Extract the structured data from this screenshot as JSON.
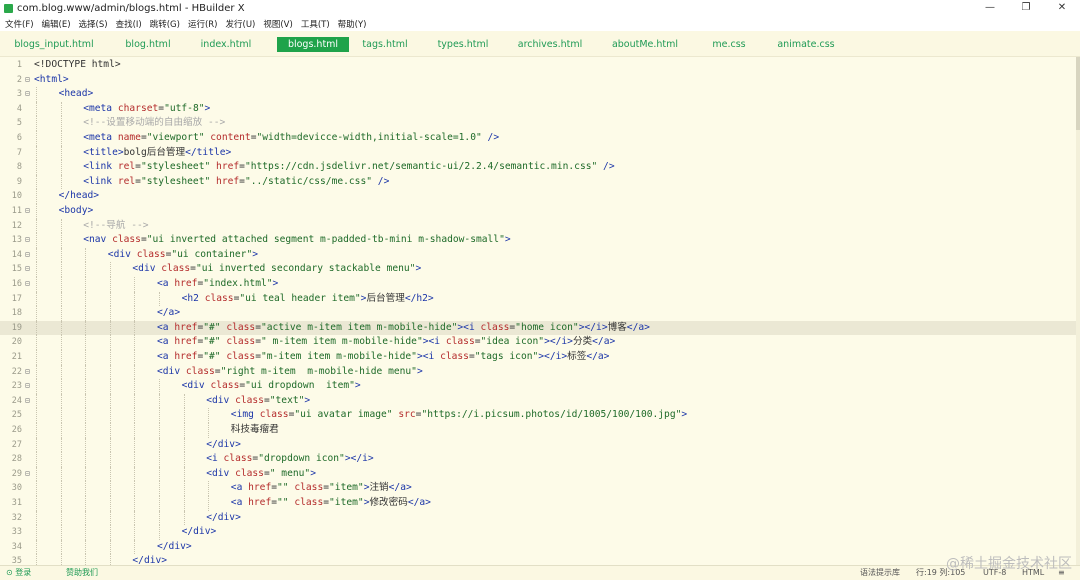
{
  "window": {
    "title": "com.blog.www/admin/blogs.html - HBuilder X",
    "minimize": "—",
    "maximize": "❐",
    "close": "✕"
  },
  "menu": [
    "文件(F)",
    "编辑(E)",
    "选择(S)",
    "查找(I)",
    "跳转(G)",
    "运行(R)",
    "发行(U)",
    "视图(V)",
    "工具(T)",
    "帮助(Y)"
  ],
  "tabs": [
    {
      "label": "blogs_input.html",
      "active": false
    },
    {
      "label": "blog.html",
      "active": false
    },
    {
      "label": "index.html",
      "active": false
    },
    {
      "label": "blogs.html",
      "active": true
    },
    {
      "label": "tags.html",
      "active": false
    },
    {
      "label": "types.html",
      "active": false
    },
    {
      "label": "archives.html",
      "active": false
    },
    {
      "label": "aboutMe.html",
      "active": false
    },
    {
      "label": "me.css",
      "active": false
    },
    {
      "label": "animate.css",
      "active": false
    }
  ],
  "editor": {
    "highlighted_line": 19,
    "lines": [
      {
        "n": "1",
        "fold": "",
        "indent": 0,
        "tokens": [
          [
            "txt",
            "<!DOCTYPE html>"
          ]
        ]
      },
      {
        "n": "2",
        "fold": "⊟",
        "indent": 0,
        "tokens": [
          [
            "tag",
            "<html>"
          ]
        ]
      },
      {
        "n": "3",
        "fold": "⊟",
        "indent": 1,
        "tokens": [
          [
            "tag",
            "<head>"
          ]
        ]
      },
      {
        "n": "4",
        "fold": "",
        "indent": 2,
        "tokens": [
          [
            "tag",
            "<meta "
          ],
          [
            "attr",
            "charset"
          ],
          [
            "txt",
            "="
          ],
          [
            "val",
            "\"utf-8\""
          ],
          [
            "tag",
            ">"
          ]
        ]
      },
      {
        "n": "5",
        "fold": "",
        "indent": 2,
        "tokens": [
          [
            "com",
            "<!--设置移动端的自由缩放 -->"
          ]
        ]
      },
      {
        "n": "6",
        "fold": "",
        "indent": 2,
        "tokens": [
          [
            "tag",
            "<meta "
          ],
          [
            "attr",
            "name"
          ],
          [
            "txt",
            "="
          ],
          [
            "val",
            "\"viewport\""
          ],
          [
            "txt",
            " "
          ],
          [
            "attr",
            "content"
          ],
          [
            "txt",
            "="
          ],
          [
            "val",
            "\"width=devicce-width,initial-scale=1.0\""
          ],
          [
            "tag",
            " />"
          ]
        ]
      },
      {
        "n": "7",
        "fold": "",
        "indent": 2,
        "tokens": [
          [
            "tag",
            "<title>"
          ],
          [
            "txt",
            "bolg后台管理"
          ],
          [
            "tag",
            "</title>"
          ]
        ]
      },
      {
        "n": "8",
        "fold": "",
        "indent": 2,
        "tokens": [
          [
            "tag",
            "<link "
          ],
          [
            "attr",
            "rel"
          ],
          [
            "txt",
            "="
          ],
          [
            "val",
            "\"stylesheet\""
          ],
          [
            "txt",
            " "
          ],
          [
            "attr",
            "href"
          ],
          [
            "txt",
            "="
          ],
          [
            "val",
            "\"https://cdn.jsdelivr.net/semantic-ui/2.2.4/semantic.min.css\""
          ],
          [
            "tag",
            " />"
          ]
        ]
      },
      {
        "n": "9",
        "fold": "",
        "indent": 2,
        "tokens": [
          [
            "tag",
            "<link "
          ],
          [
            "attr",
            "rel"
          ],
          [
            "txt",
            "="
          ],
          [
            "val",
            "\"stylesheet\""
          ],
          [
            "txt",
            " "
          ],
          [
            "attr",
            "href"
          ],
          [
            "txt",
            "="
          ],
          [
            "val",
            "\"../static/css/me.css\""
          ],
          [
            "tag",
            " />"
          ]
        ]
      },
      {
        "n": "10",
        "fold": "",
        "indent": 1,
        "tokens": [
          [
            "tag",
            "</head>"
          ]
        ]
      },
      {
        "n": "11",
        "fold": "⊟",
        "indent": 1,
        "tokens": [
          [
            "tag",
            "<body>"
          ]
        ]
      },
      {
        "n": "12",
        "fold": "",
        "indent": 2,
        "tokens": [
          [
            "com",
            "<!--导航 -->"
          ]
        ]
      },
      {
        "n": "13",
        "fold": "⊟",
        "indent": 2,
        "tokens": [
          [
            "tag",
            "<nav "
          ],
          [
            "attr",
            "class"
          ],
          [
            "txt",
            "="
          ],
          [
            "val",
            "\"ui inverted attached segment m-padded-tb-mini m-shadow-small\""
          ],
          [
            "tag",
            ">"
          ]
        ]
      },
      {
        "n": "14",
        "fold": "⊟",
        "indent": 3,
        "tokens": [
          [
            "tag",
            "<div "
          ],
          [
            "attr",
            "class"
          ],
          [
            "txt",
            "="
          ],
          [
            "val",
            "\"ui container\""
          ],
          [
            "tag",
            ">"
          ]
        ]
      },
      {
        "n": "15",
        "fold": "⊟",
        "indent": 4,
        "tokens": [
          [
            "tag",
            "<div "
          ],
          [
            "attr",
            "class"
          ],
          [
            "txt",
            "="
          ],
          [
            "val",
            "\"ui inverted secondary stackable menu\""
          ],
          [
            "tag",
            ">"
          ]
        ]
      },
      {
        "n": "16",
        "fold": "⊟",
        "indent": 5,
        "tokens": [
          [
            "tag",
            "<a "
          ],
          [
            "attr",
            "href"
          ],
          [
            "txt",
            "="
          ],
          [
            "val",
            "\"index.html\""
          ],
          [
            "tag",
            ">"
          ]
        ]
      },
      {
        "n": "17",
        "fold": "",
        "indent": 6,
        "tokens": [
          [
            "tag",
            "<h2 "
          ],
          [
            "attr",
            "class"
          ],
          [
            "txt",
            "="
          ],
          [
            "val",
            "\"ui teal header item\""
          ],
          [
            "tag",
            ">"
          ],
          [
            "txt",
            "后台管理"
          ],
          [
            "tag",
            "</h2>"
          ]
        ]
      },
      {
        "n": "18",
        "fold": "",
        "indent": 5,
        "tokens": [
          [
            "tag",
            "</a>"
          ]
        ]
      },
      {
        "n": "19",
        "fold": "",
        "indent": 5,
        "tokens": [
          [
            "tag",
            "<a "
          ],
          [
            "attr",
            "href"
          ],
          [
            "txt",
            "="
          ],
          [
            "val",
            "\"#\""
          ],
          [
            "txt",
            " "
          ],
          [
            "attr",
            "class"
          ],
          [
            "txt",
            "="
          ],
          [
            "val",
            "\"active m-item item m-mobile-hide\""
          ],
          [
            "tag",
            ">"
          ],
          [
            "tag",
            "<i "
          ],
          [
            "attr",
            "class"
          ],
          [
            "txt",
            "="
          ],
          [
            "val",
            "\"home icon\""
          ],
          [
            "tag",
            "></i>"
          ],
          [
            "txt",
            "博客"
          ],
          [
            "tag",
            "</a>"
          ]
        ]
      },
      {
        "n": "20",
        "fold": "",
        "indent": 5,
        "tokens": [
          [
            "tag",
            "<a "
          ],
          [
            "attr",
            "href"
          ],
          [
            "txt",
            "="
          ],
          [
            "val",
            "\"#\""
          ],
          [
            "txt",
            " "
          ],
          [
            "attr",
            "class"
          ],
          [
            "txt",
            "="
          ],
          [
            "val",
            "\" m-item item m-mobile-hide\""
          ],
          [
            "tag",
            ">"
          ],
          [
            "tag",
            "<i "
          ],
          [
            "attr",
            "class"
          ],
          [
            "txt",
            "="
          ],
          [
            "val",
            "\"idea icon\""
          ],
          [
            "tag",
            "></i>"
          ],
          [
            "txt",
            "分类"
          ],
          [
            "tag",
            "</a>"
          ]
        ]
      },
      {
        "n": "21",
        "fold": "",
        "indent": 5,
        "tokens": [
          [
            "tag",
            "<a "
          ],
          [
            "attr",
            "href"
          ],
          [
            "txt",
            "="
          ],
          [
            "val",
            "\"#\""
          ],
          [
            "txt",
            " "
          ],
          [
            "attr",
            "class"
          ],
          [
            "txt",
            "="
          ],
          [
            "val",
            "\"m-item item m-mobile-hide\""
          ],
          [
            "tag",
            ">"
          ],
          [
            "tag",
            "<i "
          ],
          [
            "attr",
            "class"
          ],
          [
            "txt",
            "="
          ],
          [
            "val",
            "\"tags icon\""
          ],
          [
            "tag",
            "></i>"
          ],
          [
            "txt",
            "标签"
          ],
          [
            "tag",
            "</a>"
          ]
        ]
      },
      {
        "n": "22",
        "fold": "⊟",
        "indent": 5,
        "tokens": [
          [
            "tag",
            "<div "
          ],
          [
            "attr",
            "class"
          ],
          [
            "txt",
            "="
          ],
          [
            "val",
            "\"right m-item  m-mobile-hide menu\""
          ],
          [
            "tag",
            ">"
          ]
        ]
      },
      {
        "n": "23",
        "fold": "⊟",
        "indent": 6,
        "tokens": [
          [
            "tag",
            "<div "
          ],
          [
            "attr",
            "class"
          ],
          [
            "txt",
            "="
          ],
          [
            "val",
            "\"ui dropdown  item\""
          ],
          [
            "tag",
            ">"
          ]
        ]
      },
      {
        "n": "24",
        "fold": "⊟",
        "indent": 7,
        "tokens": [
          [
            "tag",
            "<div "
          ],
          [
            "attr",
            "class"
          ],
          [
            "txt",
            "="
          ],
          [
            "val",
            "\"text\""
          ],
          [
            "tag",
            ">"
          ]
        ]
      },
      {
        "n": "25",
        "fold": "",
        "indent": 8,
        "tokens": [
          [
            "tag",
            "<img "
          ],
          [
            "attr",
            "class"
          ],
          [
            "txt",
            "="
          ],
          [
            "val",
            "\"ui avatar image\""
          ],
          [
            "txt",
            " "
          ],
          [
            "attr",
            "src"
          ],
          [
            "txt",
            "="
          ],
          [
            "val",
            "\"https://i.picsum.photos/id/1005/100/100.jpg\""
          ],
          [
            "tag",
            ">"
          ]
        ]
      },
      {
        "n": "26",
        "fold": "",
        "indent": 8,
        "tokens": [
          [
            "txt",
            "科技毒瘤君"
          ]
        ]
      },
      {
        "n": "27",
        "fold": "",
        "indent": 7,
        "tokens": [
          [
            "tag",
            "</div>"
          ]
        ]
      },
      {
        "n": "28",
        "fold": "",
        "indent": 7,
        "tokens": [
          [
            "tag",
            "<i "
          ],
          [
            "attr",
            "class"
          ],
          [
            "txt",
            "="
          ],
          [
            "val",
            "\"dropdown icon\""
          ],
          [
            "tag",
            "></i>"
          ]
        ]
      },
      {
        "n": "29",
        "fold": "⊟",
        "indent": 7,
        "tokens": [
          [
            "tag",
            "<div "
          ],
          [
            "attr",
            "class"
          ],
          [
            "txt",
            "="
          ],
          [
            "val",
            "\" menu\""
          ],
          [
            "tag",
            ">"
          ]
        ]
      },
      {
        "n": "30",
        "fold": "",
        "indent": 8,
        "tokens": [
          [
            "tag",
            "<a "
          ],
          [
            "attr",
            "href"
          ],
          [
            "txt",
            "="
          ],
          [
            "val",
            "\"\""
          ],
          [
            "txt",
            " "
          ],
          [
            "attr",
            "class"
          ],
          [
            "txt",
            "="
          ],
          [
            "val",
            "\"item\""
          ],
          [
            "tag",
            ">"
          ],
          [
            "txt",
            "注销"
          ],
          [
            "tag",
            "</a>"
          ]
        ]
      },
      {
        "n": "31",
        "fold": "",
        "indent": 8,
        "tokens": [
          [
            "tag",
            "<a "
          ],
          [
            "attr",
            "href"
          ],
          [
            "txt",
            "="
          ],
          [
            "val",
            "\"\""
          ],
          [
            "txt",
            " "
          ],
          [
            "attr",
            "class"
          ],
          [
            "txt",
            "="
          ],
          [
            "val",
            "\"item\""
          ],
          [
            "tag",
            ">"
          ],
          [
            "txt",
            "修改密码"
          ],
          [
            "tag",
            "</a>"
          ]
        ]
      },
      {
        "n": "32",
        "fold": "",
        "indent": 7,
        "tokens": [
          [
            "tag",
            "</div>"
          ]
        ]
      },
      {
        "n": "33",
        "fold": "",
        "indent": 6,
        "tokens": [
          [
            "tag",
            "</div>"
          ]
        ]
      },
      {
        "n": "34",
        "fold": "",
        "indent": 5,
        "tokens": [
          [
            "tag",
            "</div>"
          ]
        ]
      },
      {
        "n": "35",
        "fold": "",
        "indent": 4,
        "tokens": [
          [
            "tag",
            "</div>"
          ]
        ]
      }
    ]
  },
  "status": {
    "login": "登录",
    "sponsor": "赞助我们",
    "syntax_hint": "语法提示库",
    "position": "行:19  列:105",
    "encoding": "UTF-8",
    "language": "HTML",
    "extra": "≡"
  },
  "watermark": "@稀土掘金技术社区",
  "colors": {
    "editor_bg": "#fdfbe8",
    "tag": "#1c36a8",
    "attr": "#b42c2c",
    "value": "#1e6a28",
    "comment": "#a9a9a9",
    "accent_green": "#1fa34a"
  }
}
